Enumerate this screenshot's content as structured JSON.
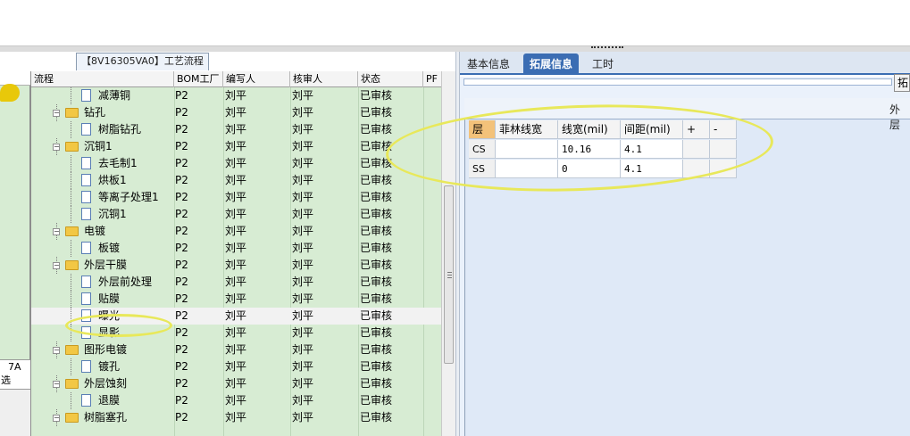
{
  "panel_title": "【8V16305VA0】工艺流程",
  "left_strip": {
    "label_line1": "7A",
    "label_line2": "选"
  },
  "grid": {
    "headers": {
      "process": "流程",
      "bom_factory": "BOM工厂",
      "author": "编写人",
      "reviewer": "核审人",
      "status": "状态",
      "pf": "PF"
    },
    "rows": [
      {
        "level": 0,
        "type": "folder",
        "name": "减薄铜",
        "bom": "P2",
        "author": "刘平",
        "reviewer": "刘平",
        "status": "已审核"
      },
      {
        "level": 1,
        "type": "doc",
        "name": "减薄铜",
        "bom": "P2",
        "author": "刘平",
        "reviewer": "刘平",
        "status": "已审核"
      },
      {
        "level": 0,
        "type": "folder",
        "name": "钻孔",
        "bom": "P2",
        "author": "刘平",
        "reviewer": "刘平",
        "status": "已审核"
      },
      {
        "level": 1,
        "type": "doc",
        "name": "树脂钻孔",
        "bom": "P2",
        "author": "刘平",
        "reviewer": "刘平",
        "status": "已审核"
      },
      {
        "level": 0,
        "type": "folder",
        "name": "沉铜1",
        "bom": "P2",
        "author": "刘平",
        "reviewer": "刘平",
        "status": "已审核"
      },
      {
        "level": 1,
        "type": "doc",
        "name": "去毛制1",
        "bom": "P2",
        "author": "刘平",
        "reviewer": "刘平",
        "status": "已审核"
      },
      {
        "level": 1,
        "type": "doc",
        "name": "烘板1",
        "bom": "P2",
        "author": "刘平",
        "reviewer": "刘平",
        "status": "已审核"
      },
      {
        "level": 1,
        "type": "doc",
        "name": "等离子处理1",
        "bom": "P2",
        "author": "刘平",
        "reviewer": "刘平",
        "status": "已审核"
      },
      {
        "level": 1,
        "type": "doc",
        "name": "沉铜1",
        "bom": "P2",
        "author": "刘平",
        "reviewer": "刘平",
        "status": "已审核"
      },
      {
        "level": 0,
        "type": "folder",
        "name": "电镀",
        "bom": "P2",
        "author": "刘平",
        "reviewer": "刘平",
        "status": "已审核"
      },
      {
        "level": 1,
        "type": "doc",
        "name": "板镀",
        "bom": "P2",
        "author": "刘平",
        "reviewer": "刘平",
        "status": "已审核"
      },
      {
        "level": 0,
        "type": "folder",
        "name": "外层干膜",
        "bom": "P2",
        "author": "刘平",
        "reviewer": "刘平",
        "status": "已审核"
      },
      {
        "level": 1,
        "type": "doc",
        "name": "外层前处理",
        "bom": "P2",
        "author": "刘平",
        "reviewer": "刘平",
        "status": "已审核"
      },
      {
        "level": 1,
        "type": "doc",
        "name": "贴膜",
        "bom": "P2",
        "author": "刘平",
        "reviewer": "刘平",
        "status": "已审核"
      },
      {
        "level": 1,
        "type": "doc",
        "name": "曝光",
        "bom": "P2",
        "author": "刘平",
        "reviewer": "刘平",
        "status": "已审核",
        "selected": true
      },
      {
        "level": 1,
        "type": "doc",
        "name": "显影",
        "bom": "P2",
        "author": "刘平",
        "reviewer": "刘平",
        "status": "已审核"
      },
      {
        "level": 0,
        "type": "folder",
        "name": "图形电镀",
        "bom": "P2",
        "author": "刘平",
        "reviewer": "刘平",
        "status": "已审核"
      },
      {
        "level": 1,
        "type": "doc",
        "name": "镀孔",
        "bom": "P2",
        "author": "刘平",
        "reviewer": "刘平",
        "status": "已审核"
      },
      {
        "level": 0,
        "type": "folder",
        "name": "外层蚀刻",
        "bom": "P2",
        "author": "刘平",
        "reviewer": "刘平",
        "status": "已审核"
      },
      {
        "level": 1,
        "type": "doc",
        "name": "退膜",
        "bom": "P2",
        "author": "刘平",
        "reviewer": "刘平",
        "status": "已审核"
      },
      {
        "level": 0,
        "type": "folder",
        "name": "树脂塞孔",
        "bom": "P2",
        "author": "刘平",
        "reviewer": "刘平",
        "status": "已审核"
      }
    ]
  },
  "right_panel": {
    "tabs": [
      "基本信息",
      "拓展信息",
      "工时"
    ],
    "active_tab": "拓展信息",
    "toolbar_button": "拓",
    "subpanel_title": "外层",
    "layer_table": {
      "headers": [
        "层",
        "菲林线宽",
        "线宽(mil)",
        "间距(mil)",
        "+",
        "-"
      ],
      "rows": [
        [
          "CS",
          "",
          "10.16",
          "4.1",
          "",
          ""
        ],
        [
          "SS",
          "",
          "0",
          "4.1",
          "",
          ""
        ]
      ]
    }
  },
  "colors": {
    "grid_bg": "#d7ecd3",
    "tab_active": "#3b6db3",
    "highlight": "#e8e85a",
    "folder": "#f2c744"
  }
}
